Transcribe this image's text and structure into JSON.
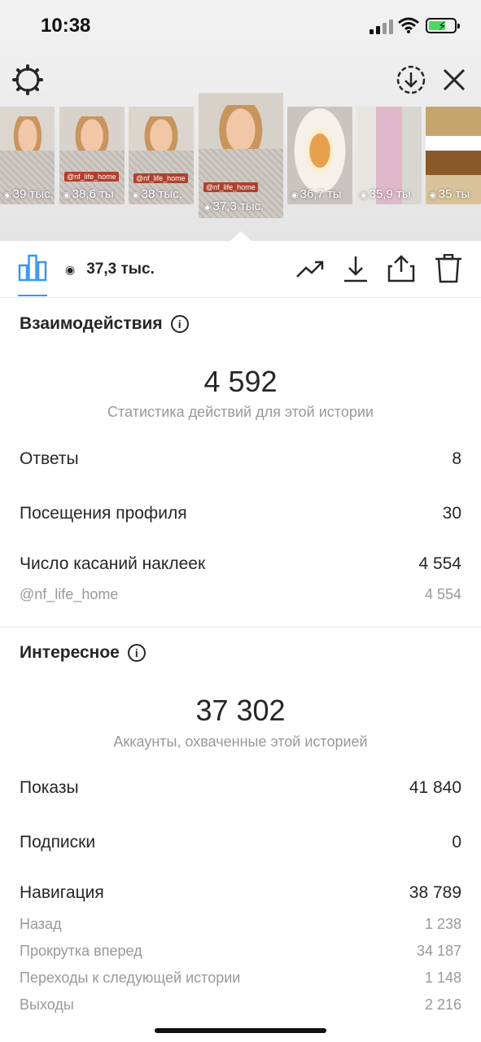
{
  "status": {
    "time": "10:38"
  },
  "thumbnails": [
    {
      "views": "39 тыс.",
      "tag": ""
    },
    {
      "views": "38,6 ты",
      "tag": "@nf_life_home"
    },
    {
      "views": "38 тыс.",
      "tag": "@nf_life_home"
    },
    {
      "views": "37,3 тыс.",
      "tag": "@nf_life_home"
    },
    {
      "views": "36,7 ты",
      "tag": ""
    },
    {
      "views": "35,9 ты",
      "tag": ""
    },
    {
      "views": "35 ты",
      "tag": ""
    }
  ],
  "actionbar": {
    "view_count": "37,3 тыс."
  },
  "interactions": {
    "title": "Взаимодействия",
    "total": "4 592",
    "caption": "Статистика действий для этой истории",
    "rows": [
      {
        "label": "Ответы",
        "value": "8"
      },
      {
        "label": "Посещения профиля",
        "value": "30"
      },
      {
        "label": "Число касаний наклеек",
        "value": "4 554"
      }
    ],
    "sub_rows": [
      {
        "label": "@nf_life_home",
        "value": "4 554"
      }
    ]
  },
  "discovery": {
    "title": "Интересное",
    "total": "37 302",
    "caption": "Аккаунты, охваченные этой историей",
    "rows": [
      {
        "label": "Показы",
        "value": "41 840"
      },
      {
        "label": "Подписки",
        "value": "0"
      },
      {
        "label": "Навигация",
        "value": "38 789"
      }
    ],
    "sub_rows": [
      {
        "label": "Назад",
        "value": "1 238"
      },
      {
        "label": "Прокрутка вперед",
        "value": "34 187"
      },
      {
        "label": "Переходы к следующей истории",
        "value": "1 148"
      },
      {
        "label": "Выходы",
        "value": "2 216"
      }
    ]
  },
  "colors": {
    "accent": "#3897f0",
    "secondary_text": "#999999"
  }
}
